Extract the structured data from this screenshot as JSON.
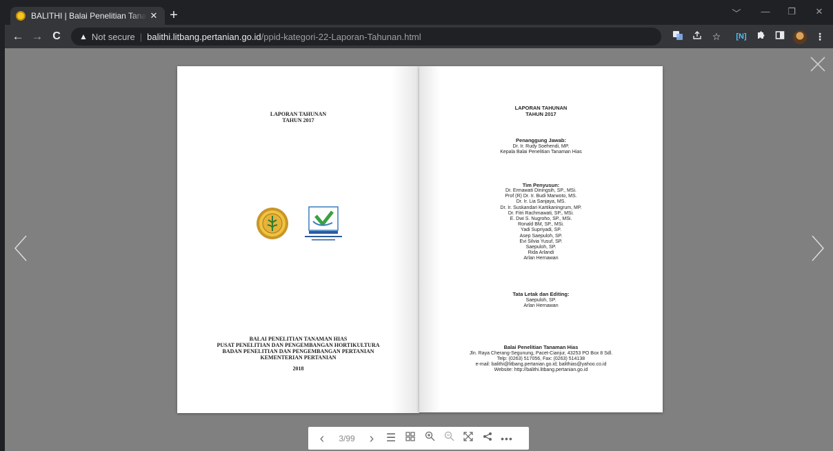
{
  "browser": {
    "tab_title": "BALITHI | Balai Penelitian Tanaman Hias",
    "tab_close": "✕",
    "new_tab": "+",
    "window_controls": [
      "﹀",
      "—",
      "❐",
      "✕"
    ],
    "url_warning": "Not secure",
    "url_host": "balithi.litbang.pertanian.go.id",
    "url_path": "/ppid-kategori-22-Laporan-Tahunan.html",
    "icons": [
      "translate-icon",
      "share-icon",
      "bookmark-star-icon",
      "extension-n-icon",
      "extensions-puzzle-icon",
      "side-panel-icon",
      "profile-avatar",
      "more-menu-icon"
    ]
  },
  "left_page": {
    "title_line1": "LAPORAN TAHUNAN",
    "title_line2": "TAHUN 2017",
    "org_line1": "BALAI PENELITIAN TANAMAN HIAS",
    "org_line2": "PUSAT PENELITIAN DAN PENGEMBANGAN HORTIKULTURA",
    "org_line3": "BADAN PENELITIAN DAN PENGEMBANGAN PERTANIAN",
    "org_line4": "KEMENTERIAN PERTANIAN",
    "year": "2018",
    "iso_badge": "MUTU INSTITUSI"
  },
  "right_page": {
    "title_line1": "LAPORAN TAHUNAN",
    "title_line2": "TAHUN 2017",
    "pj_heading": "Penanggung Jawab:",
    "pj_name": "Dr. Ir. Rudy Soehendi, MP.",
    "pj_role": "Kepala Balai Penelitian Tanaman Hias",
    "team_heading": "Tim Penyusun:",
    "team": [
      "Dr. Ermawati Diningsih, SP., MSi.",
      "Prof (R) Dr. Ir. Budi Marwoto, MS.",
      "Dr. Ir. Lia Sanjaya, MS.",
      "Dr. Ir. Suskandari Kartikaningrum, MP.",
      "Dr. Fitri Rachmawati, SP., MSi.",
      "E. Dwi S. Nugroho, SP., MSi.",
      "Ronald BM, SP., MSi.",
      "Yadi Supriyadi, SP.",
      "Asep Saepuloh, SP.",
      "Evi Silvia Yusuf, SP.",
      "Saepuloh, SP.",
      "Rida Arlandi",
      "Arlan Hernawan"
    ],
    "layout_heading": "Tata Letak dan Editing:",
    "layout_names": [
      "Saepuloh, SP.",
      "Arlan Hernawan"
    ],
    "inst_name": "Balai Penelitian Tanaman Hias",
    "inst_address": "Jln. Raya Cherang-Segunung, Pacet-Cianjur, 43253 PO Box 8 Sdl.",
    "inst_phone": "Telp: (0263) 517056, Fax: (0263) 514138",
    "inst_email": "e-mail: balithi@litbang.pertanian.go.id; balithias@yahoo.co.id",
    "inst_web": "Website: http://balithi.litbang.pertanian.go.id"
  },
  "controls": {
    "page_indicator": "3/99",
    "icons": [
      "prev-page-icon",
      "next-page-icon",
      "table-of-contents-icon",
      "thumbnails-icon",
      "zoom-in-icon",
      "zoom-out-icon",
      "fullscreen-icon",
      "share-icon",
      "more-options-icon"
    ]
  },
  "colors": {
    "chrome_dark": "#202124",
    "toolbar": "#35363a",
    "viewer_bg": "#808080",
    "page": "#ffffff"
  }
}
